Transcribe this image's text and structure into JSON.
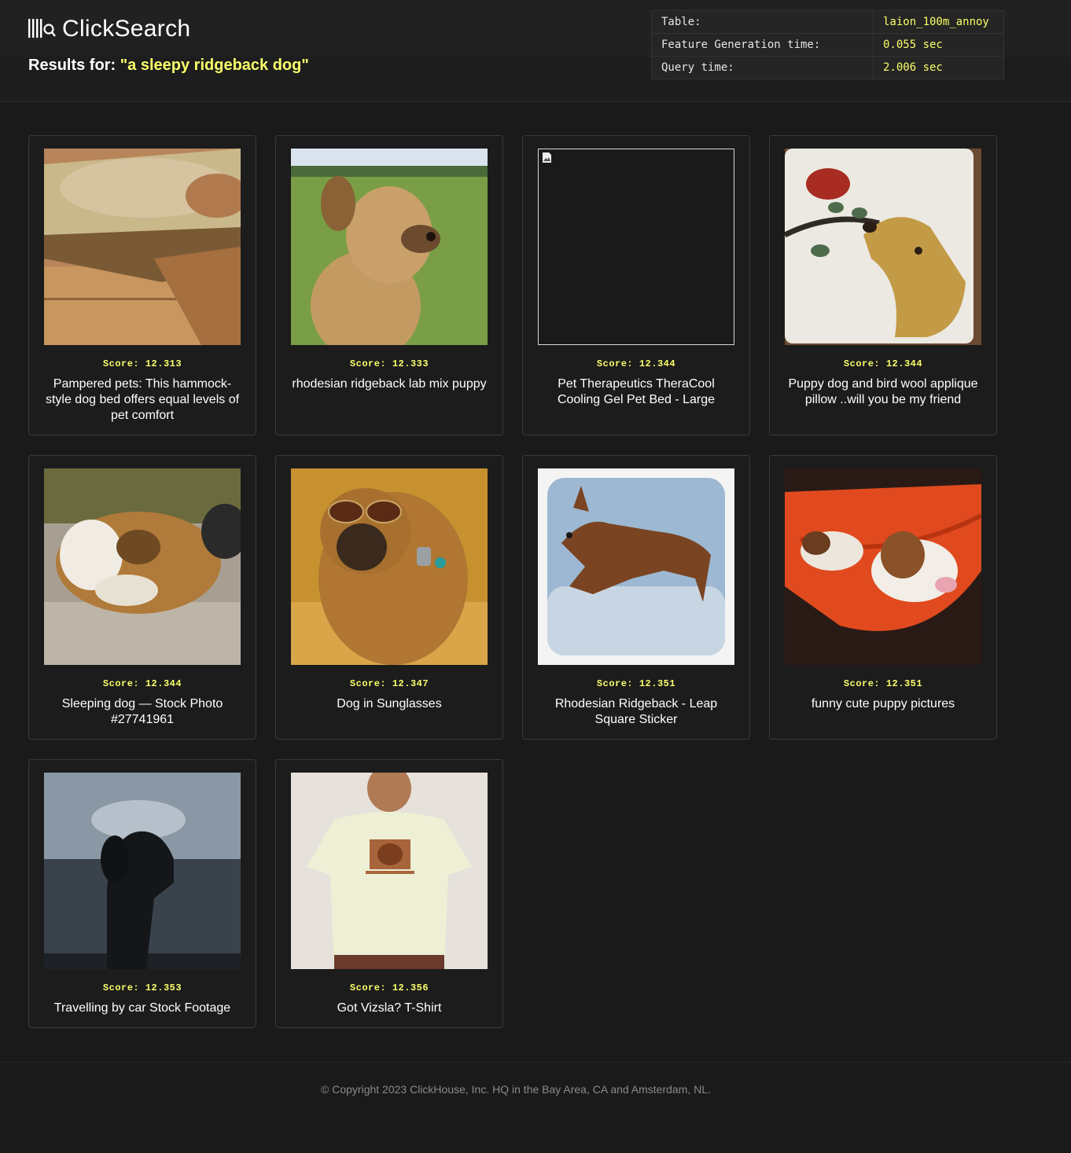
{
  "brand": {
    "name": "ClickSearch"
  },
  "results": {
    "prefix": "Results for: ",
    "query": "\"a sleepy ridgeback dog\""
  },
  "stats": [
    {
      "label": "Table:",
      "value": "laion_100m_annoy"
    },
    {
      "label": "Feature Generation time:",
      "value": "0.055 sec"
    },
    {
      "label": "Query time:",
      "value": "2.006 sec"
    }
  ],
  "score_prefix": "Score: ",
  "cards": [
    {
      "score": "12.313",
      "caption": "Pampered pets: This hammock-style dog bed offers equal levels of pet comfort",
      "image": "dog lying on wooden hammock bed"
    },
    {
      "score": "12.333",
      "caption": "rhodesian ridgeback lab mix puppy",
      "image": "tan puppy on grass"
    },
    {
      "score": "12.344",
      "caption": "Pet Therapeutics TheraCool Cooling Gel Pet Bed - Large",
      "image": "broken-image-icon"
    },
    {
      "score": "12.344",
      "caption": "Puppy dog and bird wool applique pillow ..will you be my friend",
      "image": "felt dog and red bird pillow"
    },
    {
      "score": "12.344",
      "caption": "Sleeping dog — Stock Photo #27741961",
      "image": "collie lying on gravel"
    },
    {
      "score": "12.347",
      "caption": "Dog in Sunglasses",
      "image": "dog wearing sunglasses"
    },
    {
      "score": "12.351",
      "caption": "Rhodesian Ridgeback - Leap Square Sticker",
      "image": "ridgeback leaping sticker"
    },
    {
      "score": "12.351",
      "caption": "funny cute puppy pictures",
      "image": "puppies in orange hammock"
    },
    {
      "score": "12.353",
      "caption": "Travelling by car Stock Footage",
      "image": "dog silhouette at car window"
    },
    {
      "score": "12.356",
      "caption": "Got Vizsla? T-Shirt",
      "image": "man wearing vizsla t-shirt"
    }
  ],
  "footer": {
    "text": "© Copyright 2023 ClickHouse, Inc. HQ in the Bay Area, CA and Amsterdam, NL."
  },
  "colors": {
    "accent": "#faff69",
    "background": "#1a1a1a",
    "card_border": "#3a3a3a"
  }
}
